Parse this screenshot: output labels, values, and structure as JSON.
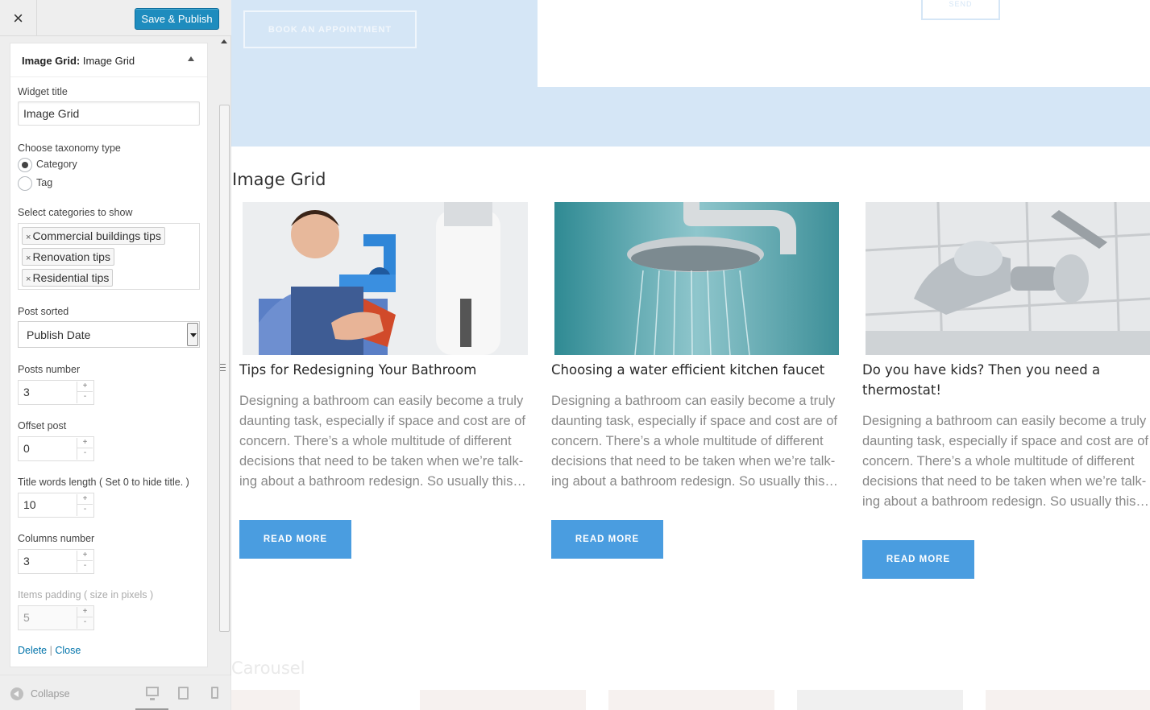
{
  "sidebar": {
    "close_glyph": "×",
    "publish_label": "Save & Publish",
    "widget_header_bold": "Image Grid:",
    "widget_header_rest": " Image Grid",
    "widget_title_label": "Widget title",
    "widget_title_value": "Image Grid",
    "taxonomy_label": "Choose taxonomy type",
    "taxonomy_options": [
      "Category",
      "Tag"
    ],
    "taxonomy_selected": "Category",
    "categories_label": "Select categories to show",
    "categories": [
      "Commercial buildings tips",
      "Renovation tips",
      "Residential tips"
    ],
    "tag_remove_glyph": "×",
    "sorted_label": "Post sorted",
    "sorted_value": "Publish Date",
    "posts_number_label": "Posts number",
    "posts_number_value": "3",
    "offset_label": "Offset post",
    "offset_value": "0",
    "title_words_label": "Title words length ( Set 0 to hide title. )",
    "title_words_value": "10",
    "columns_label": "Columns number",
    "columns_value": "3",
    "padding_label": "Items padding ( size in pixels )",
    "padding_value": "5",
    "spin_up": "+",
    "spin_down": "-",
    "delete_link": "Delete",
    "link_sep": "|",
    "close_link": "Close",
    "collapse_label": "Collapse"
  },
  "preview": {
    "book_button": "BOOK AN APPOINTMENT",
    "send_button": "SEND",
    "section_title": "Image Grid",
    "posts": [
      {
        "title": "Tips for Redesigning Your Bathroom",
        "excerpt": "Designing a bathroom can easily become a truly daunting task, especially if space and cost are of concern. There’s a whole multitude of different decisions that need to be taken when we’re talk­ing about a bathroom redesign. So usually this…",
        "button": "READ MORE",
        "image": "plumber-with-wrench"
      },
      {
        "title": "Choosing a water efficient kitchen faucet",
        "excerpt": "Designing a bathroom can easily become a truly daunting task, especially if space and cost are of concern. There’s a whole multitude of different decisions that need to be taken when we’re talk­ing about a bathroom redesign. So usually this…",
        "button": "READ MORE",
        "image": "rain-shower-head"
      },
      {
        "title": "Do you have kids? Then you need a thermo­stat!",
        "excerpt": "Designing a bathroom can easily become a truly daunting task, especially if space and cost are of concern. There’s a whole multitude of different decisions that need to be taken when we’re talk­ing about a bathroom redesign. So usually this…",
        "button": "READ MORE",
        "image": "chrome-bath-faucet"
      }
    ],
    "next_section_title": "Carousel"
  },
  "colors": {
    "publish_blue": "#1e8cbe",
    "hero_bg": "#d5e6f6",
    "read_more_blue": "#4a9de0",
    "link_blue": "#0073aa"
  }
}
